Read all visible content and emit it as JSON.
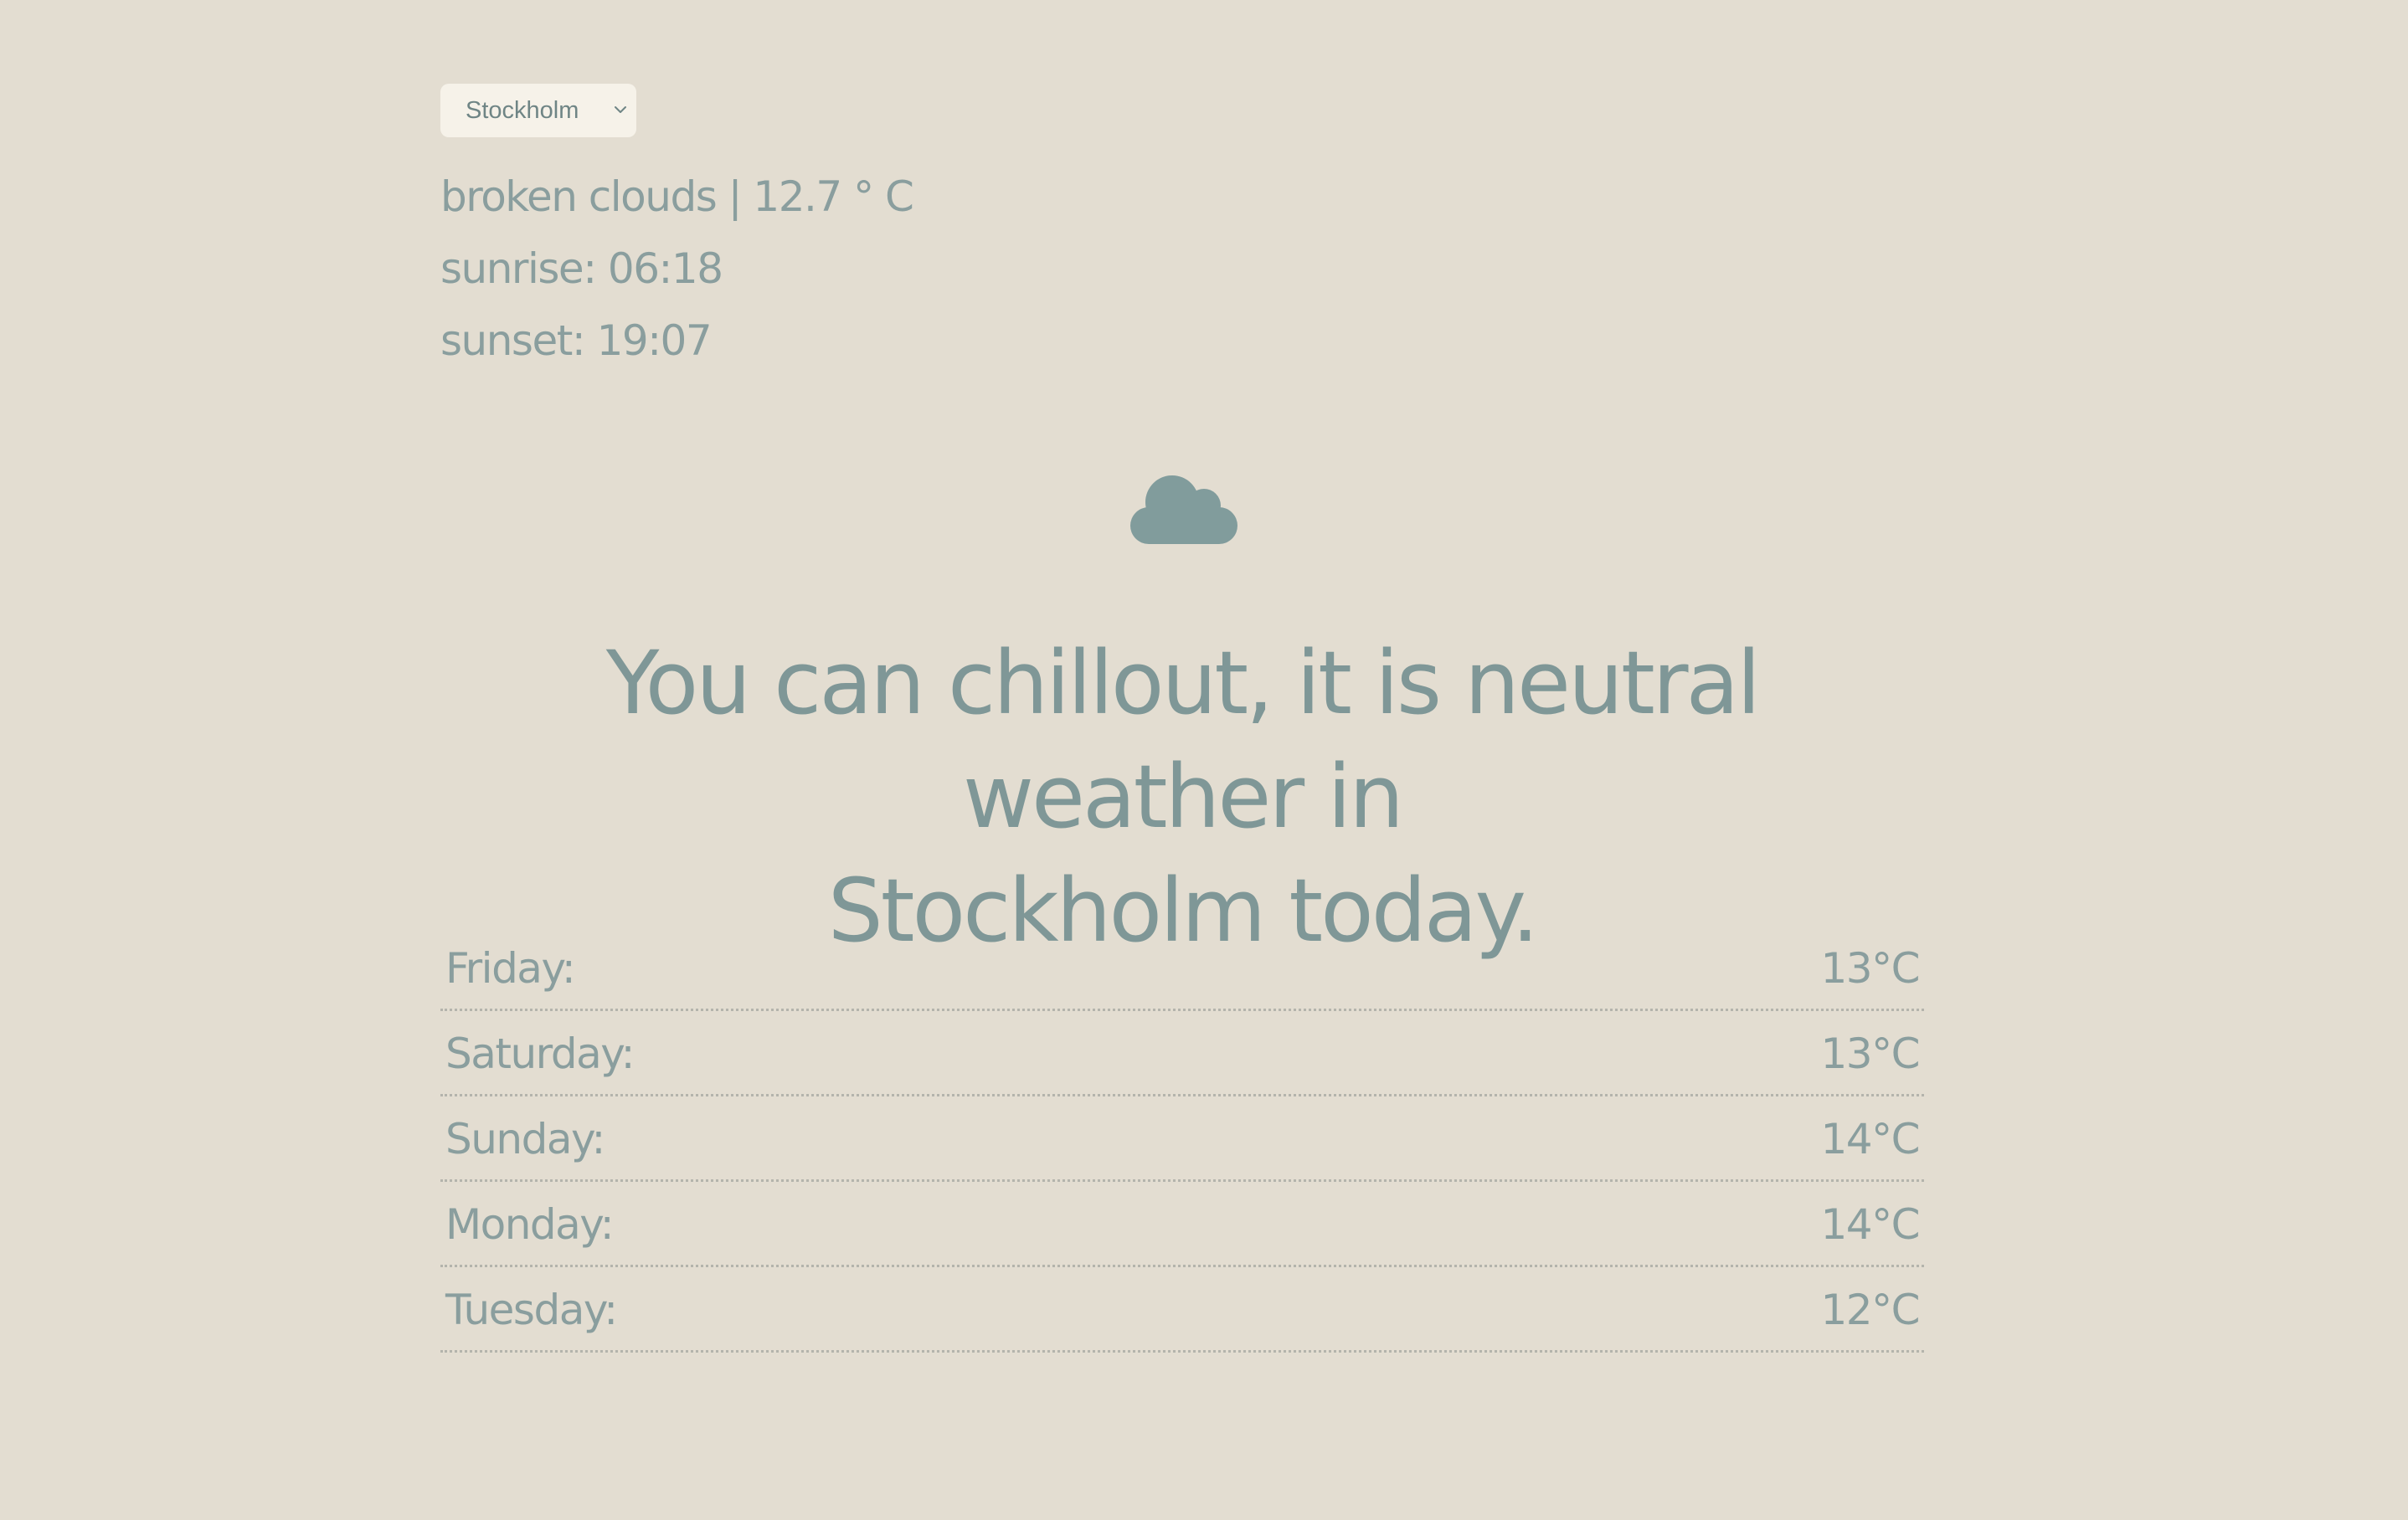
{
  "city_select": {
    "selected": "Stockholm"
  },
  "current": {
    "description_line": "broken clouds | 12.7 ° C",
    "sunrise_line": "sunrise: 06:18",
    "sunset_line": "sunset: 19:07"
  },
  "weather_icon": "cloud-icon",
  "headline_lines": [
    "You can chillout, it is neutral weather in",
    "Stockholm today."
  ],
  "forecast": [
    {
      "day": "Friday:",
      "temp": "13°C"
    },
    {
      "day": "Saturday:",
      "temp": "13°C"
    },
    {
      "day": "Sunday:",
      "temp": "14°C"
    },
    {
      "day": "Monday:",
      "temp": "14°C"
    },
    {
      "day": "Tuesday:",
      "temp": "12°C"
    }
  ],
  "colors": {
    "background": "#e3ddd1",
    "text": "#8a9e9e",
    "icon": "#819c9c",
    "select_background": "#f6f2e9"
  }
}
